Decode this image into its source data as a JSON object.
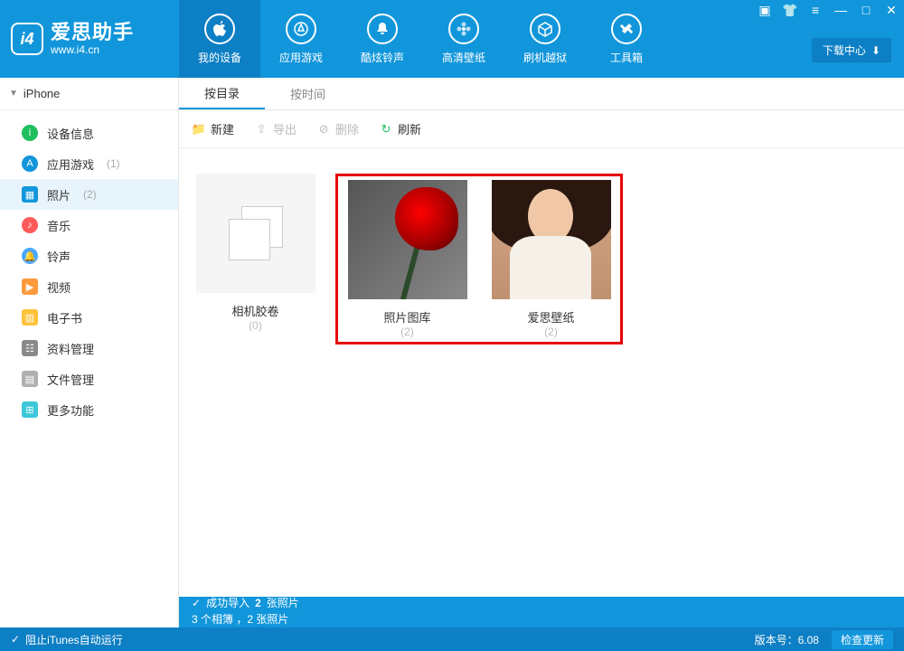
{
  "app": {
    "title": "爱思助手",
    "subtitle": "www.i4.cn"
  },
  "nav": [
    {
      "label": "我的设备",
      "icon": "apple"
    },
    {
      "label": "应用游戏",
      "icon": "appstore"
    },
    {
      "label": "酷炫铃声",
      "icon": "bell"
    },
    {
      "label": "高清壁纸",
      "icon": "flower"
    },
    {
      "label": "刷机越狱",
      "icon": "box"
    },
    {
      "label": "工具箱",
      "icon": "tools"
    }
  ],
  "download_center": "下载中心",
  "sidebar": {
    "device": "iPhone",
    "items": [
      {
        "label": "设备信息",
        "color": "#1dbf5e",
        "count": ""
      },
      {
        "label": "应用游戏",
        "color": "#1296db",
        "count": "(1)"
      },
      {
        "label": "照片",
        "color": "#1296db",
        "count": "(2)",
        "active": true
      },
      {
        "label": "音乐",
        "color": "#ff5b5b",
        "count": ""
      },
      {
        "label": "铃声",
        "color": "#4aa8ff",
        "count": ""
      },
      {
        "label": "视频",
        "color": "#ff9a3c",
        "count": ""
      },
      {
        "label": "电子书",
        "color": "#ffc23c",
        "count": ""
      },
      {
        "label": "资料管理",
        "color": "#8a8a8a",
        "count": ""
      },
      {
        "label": "文件管理",
        "color": "#b0b0b0",
        "count": ""
      },
      {
        "label": "更多功能",
        "color": "#3cc8d8",
        "count": ""
      }
    ]
  },
  "tabs": [
    {
      "label": "按目录",
      "active": true
    },
    {
      "label": "按时间",
      "active": false
    }
  ],
  "toolbar": {
    "new": "新建",
    "export": "导出",
    "delete": "删除",
    "refresh": "刷新"
  },
  "albums": [
    {
      "name": "相机胶卷",
      "count": "(0)",
      "type": "empty"
    },
    {
      "name": "照片图库",
      "count": "(2)",
      "type": "rose"
    },
    {
      "name": "爱思壁纸",
      "count": "(2)",
      "type": "girl"
    }
  ],
  "status": {
    "success_prefix": "成功导入",
    "success_count": "2",
    "success_suffix": "张照片",
    "summary": "3 个相簿 ，2 张照片"
  },
  "footer": {
    "itunes": "阻止iTunes自动运行",
    "version_label": "版本号：",
    "version": "6.08",
    "check_update": "检查更新"
  }
}
